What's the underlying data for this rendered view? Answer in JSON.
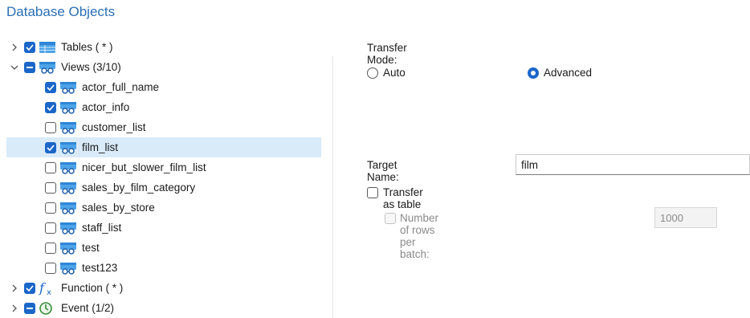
{
  "header": {
    "title": "Database Objects"
  },
  "tree": {
    "tables": {
      "label": "Tables ( * )"
    },
    "views": {
      "label": "Views (3/10)"
    },
    "view_items": [
      {
        "label": "actor_full_name"
      },
      {
        "label": "actor_info"
      },
      {
        "label": "customer_list"
      },
      {
        "label": "film_list"
      },
      {
        "label": "nicer_but_slower_film_list"
      },
      {
        "label": "sales_by_film_category"
      },
      {
        "label": "sales_by_store"
      },
      {
        "label": "staff_list"
      },
      {
        "label": "test"
      },
      {
        "label": "test123"
      }
    ],
    "function": {
      "label": "Function ( * )"
    },
    "event": {
      "label": "Event (1/2)"
    }
  },
  "transfer": {
    "mode_label": "Transfer Mode:",
    "auto_label": "Auto",
    "advanced_label": "Advanced",
    "selected_mode": "Advanced",
    "target_name_label": "Target Name:",
    "target_name_value": "film",
    "transfer_as_table_label": "Transfer as table",
    "rows_per_batch_label": "Number of rows per batch:",
    "rows_per_batch_value": "1000"
  },
  "colors": {
    "accent": "#1b66c9",
    "header": "#2a6fb6",
    "selection": "#d9ebf9"
  }
}
